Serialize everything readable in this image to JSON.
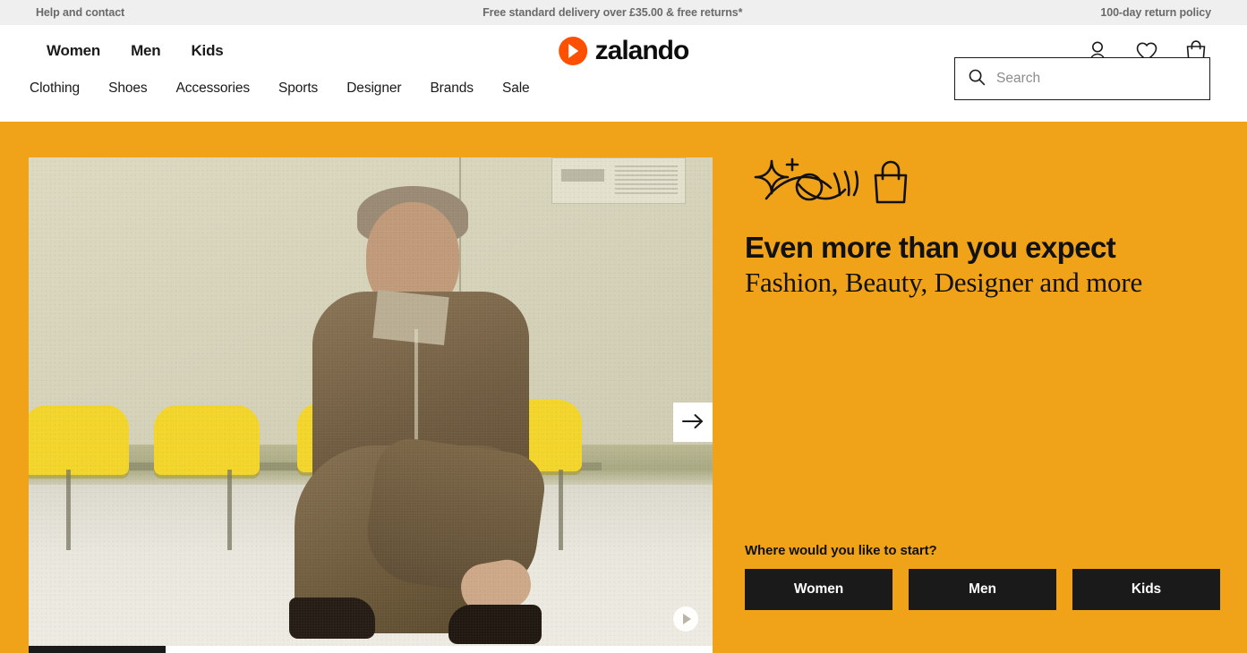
{
  "utility_bar": {
    "help_link": "Help and contact",
    "delivery_notice": "Free standard delivery over £35.00 & free returns*",
    "return_policy": "100-day return policy"
  },
  "header": {
    "logo_text": "zalando",
    "primary_nav": [
      {
        "label": "Women"
      },
      {
        "label": "Men"
      },
      {
        "label": "Kids"
      }
    ],
    "secondary_nav": [
      {
        "label": "Clothing"
      },
      {
        "label": "Shoes"
      },
      {
        "label": "Accessories"
      },
      {
        "label": "Sports"
      },
      {
        "label": "Designer"
      },
      {
        "label": "Brands"
      },
      {
        "label": "Sale"
      }
    ],
    "icons": [
      {
        "name": "account-icon"
      },
      {
        "name": "wishlist-heart-icon"
      },
      {
        "name": "shopping-bag-icon"
      }
    ],
    "search": {
      "placeholder": "Search",
      "value": "",
      "icon": "search-icon"
    }
  },
  "hero": {
    "background_color": "#f0a318",
    "decorative_icon": "sparkle-eye-bag-icon",
    "title": "Even more than you expect",
    "subtitle": "Fashion, Beauty, Designer and more",
    "start_prompt": "Where would you like to start?",
    "cta_buttons": [
      {
        "label": "Women"
      },
      {
        "label": "Men"
      },
      {
        "label": "Kids"
      }
    ],
    "carousel": {
      "next_icon": "arrow-right-icon",
      "play_icon": "play-icon",
      "progress_percent": 20
    },
    "image_alt": "Man in brown suede jacket crouching in front of yellow chairs"
  }
}
